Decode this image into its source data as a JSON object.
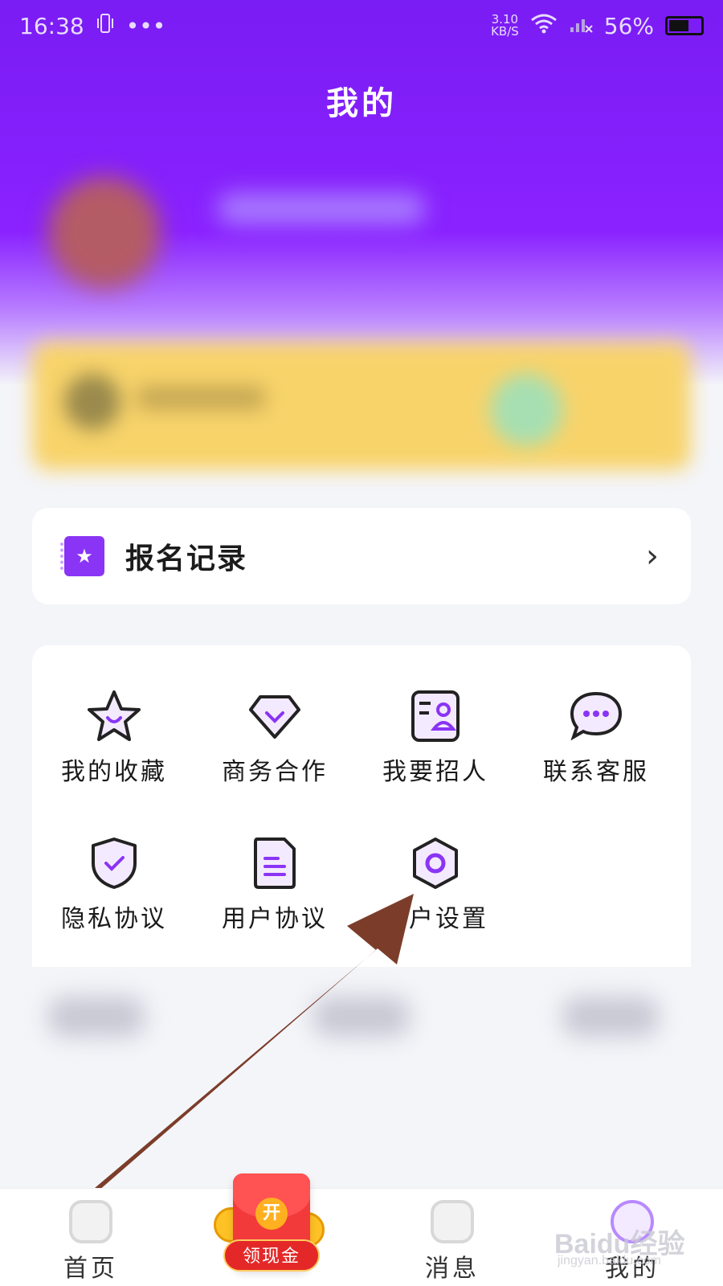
{
  "status_bar": {
    "time": "16:38",
    "network_speed": "3.10",
    "network_unit": "KB/S",
    "battery": "56%"
  },
  "header": {
    "title": "我的"
  },
  "signup_record": {
    "label": "报名记录"
  },
  "grid": {
    "items": [
      {
        "label": "我的收藏",
        "icon": "star-icon"
      },
      {
        "label": "商务合作",
        "icon": "diamond-icon"
      },
      {
        "label": "我要招人",
        "icon": "recruit-card-icon"
      },
      {
        "label": "联系客服",
        "icon": "chat-bubble-icon"
      },
      {
        "label": "隐私协议",
        "icon": "shield-check-icon"
      },
      {
        "label": "用户协议",
        "icon": "document-icon"
      },
      {
        "label": "用户设置",
        "icon": "hexagon-settings-icon"
      }
    ]
  },
  "tab_bar": {
    "home": "首页",
    "redeem": "领现金",
    "redeem_badge": "开",
    "messages": "消息",
    "mine": "我的"
  },
  "watermark": {
    "main": "Baidu经验",
    "sub": "jingyan.baidu.com"
  },
  "colors": {
    "accent": "#8a22ff",
    "signup_icon": "#8a34f5",
    "arrow": "#7b3d2a"
  }
}
